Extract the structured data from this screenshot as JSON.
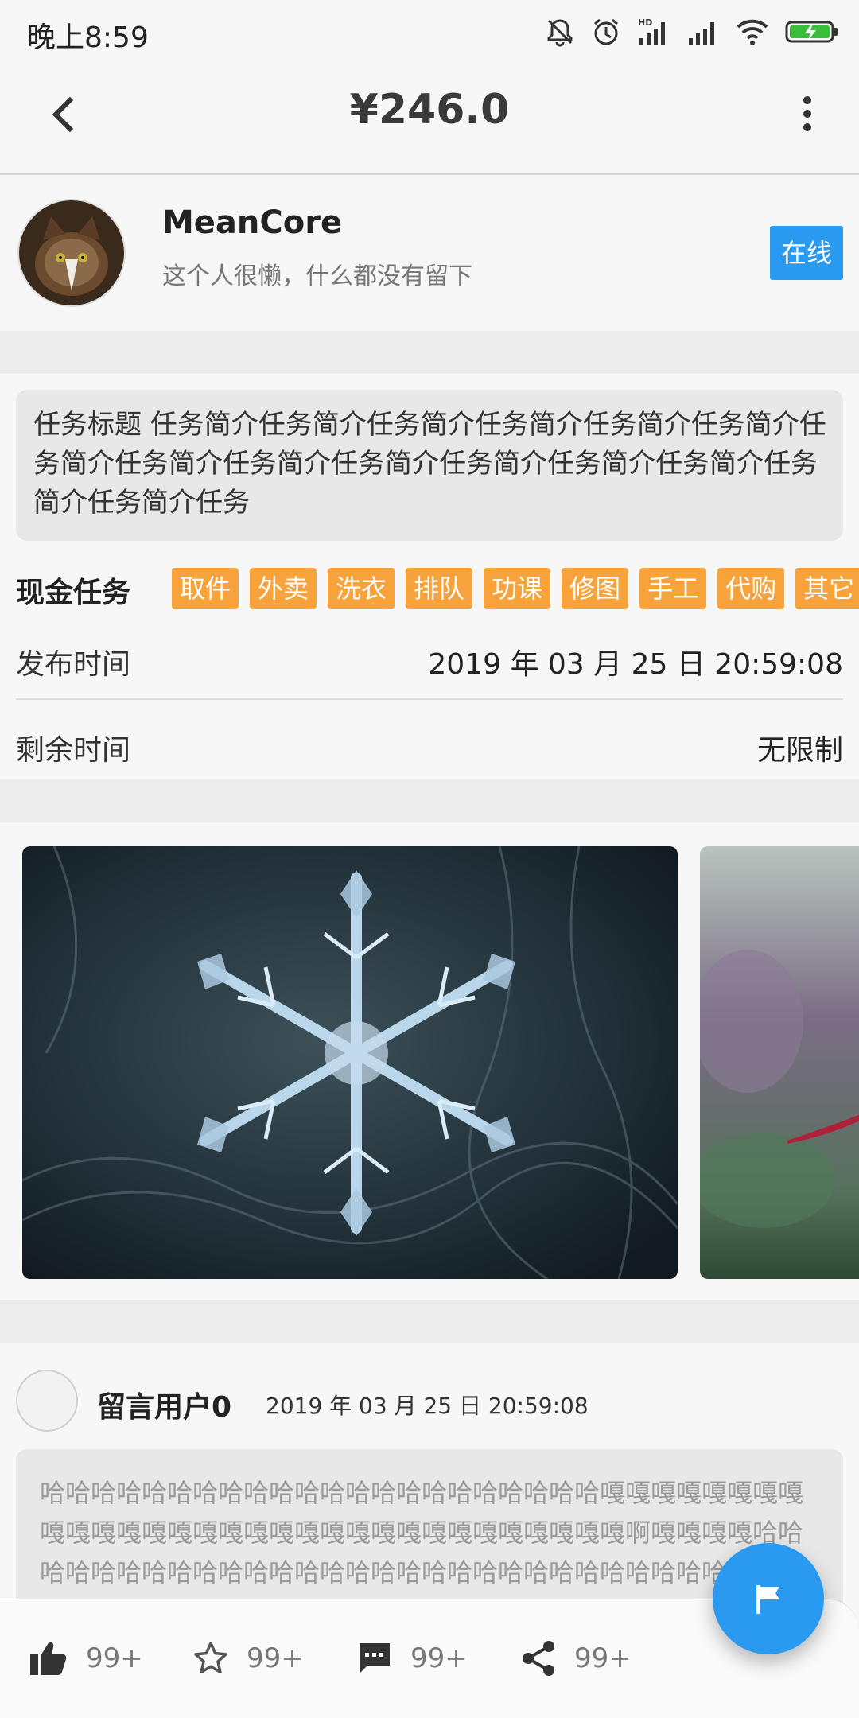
{
  "status_bar": {
    "time": "晚上8:59",
    "icons": [
      "mute-bell-icon",
      "alarm-icon",
      "hd-signal-icon",
      "signal-icon",
      "wifi-icon",
      "battery-charging-icon"
    ]
  },
  "header": {
    "title": "¥246.0",
    "back_icon": "back-arrow-icon",
    "more_icon": "more-vert-icon"
  },
  "profile": {
    "name": "MeanCore",
    "bio": "这个人很懒，什么都没有留下",
    "status_label": "在线"
  },
  "task": {
    "description": "任务标题  任务简介任务简介任务简介任务简介任务简介任务简介任务简介任务简介任务简介任务简介任务简介任务简介任务简介任务简介任务简介任务",
    "category": "现金任务",
    "tags": [
      "取件",
      "外卖",
      "洗衣",
      "排队",
      "功课",
      "修图",
      "手工",
      "代购",
      "其它"
    ],
    "publish_label": "发布时间",
    "publish_time": "2019 年 03 月 25 日 20:59:08",
    "remaining_label": "剩余时间",
    "remaining_value": "无限制"
  },
  "images": [
    {
      "name": "snowflake-photo"
    },
    {
      "name": "flower-photo"
    }
  ],
  "comment": {
    "user": "留言用户0",
    "time": "2019 年 03 月 25 日 20:59:08",
    "text": "哈哈哈哈哈哈哈哈哈哈哈哈哈哈哈哈哈哈哈哈哈哈嘎嘎嘎嘎嘎嘎嘎嘎嘎嘎嘎嘎嘎嘎嘎嘎嘎嘎嘎嘎嘎嘎嘎嘎嘎嘎嘎嘎嘎嘎嘎啊嘎嘎嘎嘎哈哈哈哈哈哈哈哈哈哈哈哈哈哈哈哈哈哈哈哈哈哈哈哈哈哈哈哈哈哈哈哈哈哈哈哈哈哈哈哈哈哈哈"
  },
  "actions": {
    "like_count": "99+",
    "star_count": "99+",
    "comment_count": "99+",
    "share_count": "99+"
  },
  "colors": {
    "accent": "#2a9af0",
    "tag": "#f7a23a"
  }
}
